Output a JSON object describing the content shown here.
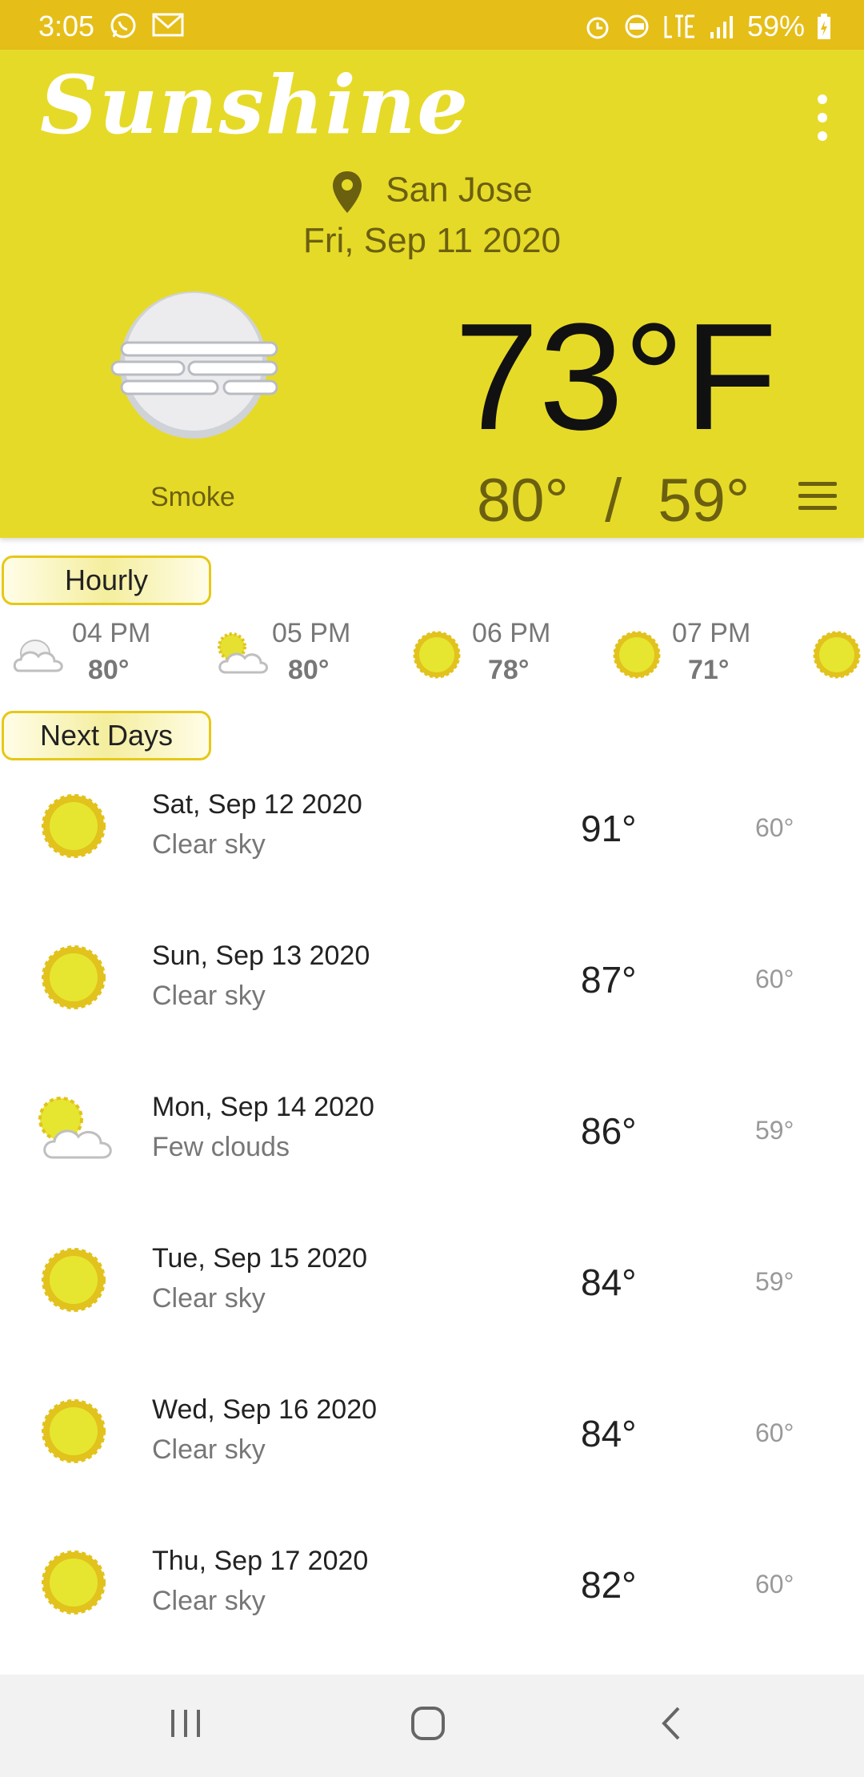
{
  "status_bar": {
    "time": "3:05",
    "battery": "59%",
    "left_icons": [
      "whatsapp-icon",
      "mail-icon"
    ],
    "right_icons": [
      "alarm-icon",
      "volte-icon",
      "lte-icon",
      "signal-icon",
      "battery-icon"
    ]
  },
  "header": {
    "app_title": "Sunshine",
    "location": "San Jose",
    "date": "Fri, Sep 11 2020",
    "temperature": "73°F",
    "condition": "Smoke",
    "high": "80°",
    "separator": "/",
    "low": "59°",
    "colors": {
      "background": "#e6da28",
      "status_bar": "#e6be18",
      "accent_text": "#6b6010"
    }
  },
  "hourly": {
    "label": "Hourly",
    "items": [
      {
        "time": "04 PM",
        "temp": "80°",
        "icon": "cloudy-icon"
      },
      {
        "time": "05 PM",
        "temp": "80°",
        "icon": "partly-cloudy-icon"
      },
      {
        "time": "06 PM",
        "temp": "78°",
        "icon": "sun-icon"
      },
      {
        "time": "07 PM",
        "temp": "71°",
        "icon": "sun-icon"
      },
      {
        "time": "",
        "temp": "",
        "icon": "sun-icon"
      }
    ]
  },
  "next_days": {
    "label": "Next Days",
    "items": [
      {
        "date": "Sat, Sep 12 2020",
        "desc": "Clear sky",
        "high": "91°",
        "low": "60°",
        "icon": "sun-icon"
      },
      {
        "date": "Sun, Sep 13 2020",
        "desc": "Clear sky",
        "high": "87°",
        "low": "60°",
        "icon": "sun-icon"
      },
      {
        "date": "Mon, Sep 14 2020",
        "desc": "Few clouds",
        "high": "86°",
        "low": "59°",
        "icon": "partly-cloudy-icon"
      },
      {
        "date": "Tue, Sep 15 2020",
        "desc": "Clear sky",
        "high": "84°",
        "low": "59°",
        "icon": "sun-icon"
      },
      {
        "date": "Wed, Sep 16 2020",
        "desc": "Clear sky",
        "high": "84°",
        "low": "60°",
        "icon": "sun-icon"
      },
      {
        "date": "Thu, Sep 17 2020",
        "desc": "Clear sky",
        "high": "82°",
        "low": "60°",
        "icon": "sun-icon"
      }
    ]
  },
  "nav_bar": {
    "buttons": [
      "recent-apps-icon",
      "home-icon",
      "back-icon"
    ]
  }
}
